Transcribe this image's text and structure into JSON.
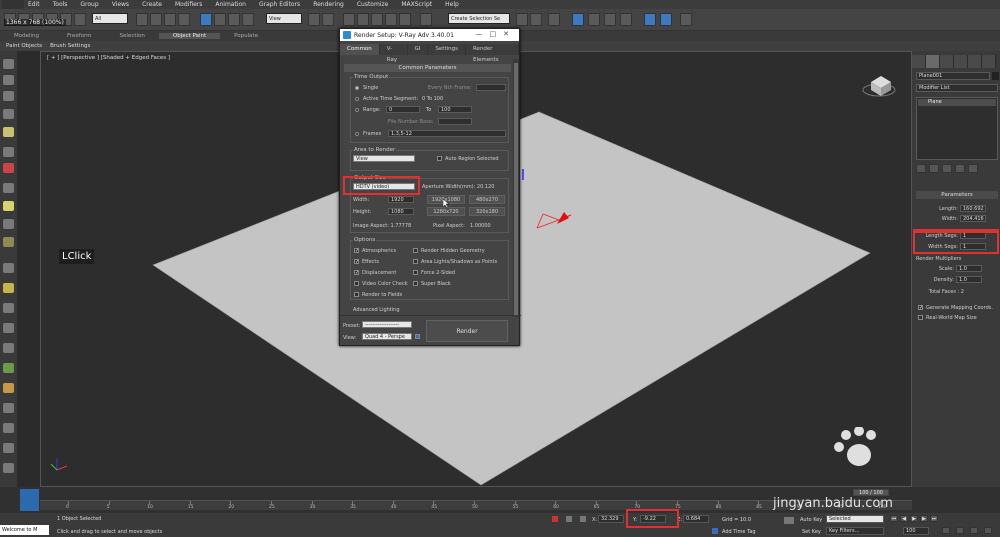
{
  "menu": {
    "items": [
      "Edit",
      "Tools",
      "Group",
      "Views",
      "Create",
      "Modifiers",
      "Animation",
      "Graph Editors",
      "Rendering",
      "Customize",
      "MAXScript",
      "Help"
    ]
  },
  "toolbar": {
    "selection_filter": "All",
    "ref_coord": "View",
    "named_selection": "Create Selection Se"
  },
  "screen_overlay": {
    "resolution": "1366 x 768 (100%)"
  },
  "ribbon": {
    "tabs": [
      "Modeling",
      "Freeform",
      "Selection",
      "Object Paint",
      "Populate"
    ],
    "active_tab": "Object Paint",
    "sub_items": [
      "Paint Objects",
      "Brush Settings"
    ]
  },
  "viewport": {
    "label": "[ + ] [Perspective ] [Shaded + Edged Faces ]",
    "click_label": "LClick"
  },
  "dialog": {
    "title": "Render Setup: V-Ray Adv 3.40.01",
    "tabs": [
      "Common",
      "V-Ray",
      "GI",
      "Settings",
      "Render Elements"
    ],
    "rollout_title": "Common Parameters",
    "time_output": {
      "label": "Time Output",
      "single": "Single",
      "every_nth": "Every Nth Frame:",
      "active_segment": "Active Time Segment:",
      "active_segment_value": "0 To 100",
      "range": "Range:",
      "range_from": "0",
      "to": "To",
      "range_to": "100",
      "file_number_base": "File Number Base:",
      "frames": "Frames",
      "frames_value": "1,3,5-12"
    },
    "area": {
      "label": "Area to Render",
      "value": "View",
      "auto_region": "Auto Region Selected"
    },
    "output_size": {
      "label": "Output Size",
      "preset": "HDTV (video)",
      "aperture": "Aperture Width(mm): 20.120",
      "width_label": "Width:",
      "width": "1920",
      "height_label": "Height:",
      "height": "1080",
      "presets": [
        "1920x1080",
        "480x270",
        "1280x720",
        "320x180"
      ],
      "image_aspect": "Image Aspect: 1.77778",
      "pixel_aspect": "Pixel Aspect:",
      "pixel_aspect_value": "1.00000"
    },
    "options": {
      "label": "Options",
      "atmospherics": "Atmospherics",
      "render_hidden": "Render Hidden Geometry",
      "effects": "Effects",
      "area_lights": "Area Lights/Shadows as Points",
      "displacement": "Displacement",
      "force_2sided": "Force 2-Sided",
      "video_color": "Video Color Check",
      "super_black": "Super Black",
      "render_fields": "Render to Fields"
    },
    "advanced_lighting": "Advanced Lighting",
    "preset_label": "Preset:",
    "preset_value": "-------------------",
    "view_label": "View:",
    "view_value": "Quad 4 - Perspe",
    "render_button": "Render"
  },
  "command_panel": {
    "object_name": "Plane001",
    "modifier_list": "Modifier List",
    "stack_item": "Plane",
    "parameters": "Parameters",
    "length_label": "Length:",
    "length": "160.692",
    "width_label": "Width:",
    "width": "204.416",
    "length_segs_label": "Length Segs:",
    "length_segs": "1",
    "width_segs_label": "Width Segs:",
    "width_segs": "1",
    "render_multipliers": "Render Multipliers",
    "scale_label": "Scale:",
    "scale": "1.0",
    "density_label": "Density:",
    "density": "1.0",
    "total_faces": "Total Faces : 2",
    "gen_mapping": "Generate Mapping Coords.",
    "real_world": "Real-World Map Size"
  },
  "timeline": {
    "frame": "100 / 100",
    "ticks": [
      "0",
      "5",
      "10",
      "15",
      "20",
      "25",
      "30",
      "35",
      "40",
      "45",
      "50",
      "55",
      "60",
      "65",
      "70",
      "75",
      "80",
      "85",
      "90",
      "95",
      "100"
    ]
  },
  "status": {
    "welcome": "Welcome to M",
    "selected": "1 Object Selected",
    "hint": "Click and drag to select and move objects",
    "x_label": "X:",
    "x": "32.329",
    "y_label": "Y:",
    "y": "-9.22",
    "z_label": "Z:",
    "z": "0.684",
    "grid": "Grid = 10.0",
    "add_time_tag": "Add Time Tag",
    "auto_key": "Auto Key",
    "auto_key_value": "Selected",
    "set_key": "Set Key",
    "key_filters": "Key Filters...",
    "frame_field": "100"
  },
  "watermark": {
    "url": "jingyan.baidu.com"
  }
}
